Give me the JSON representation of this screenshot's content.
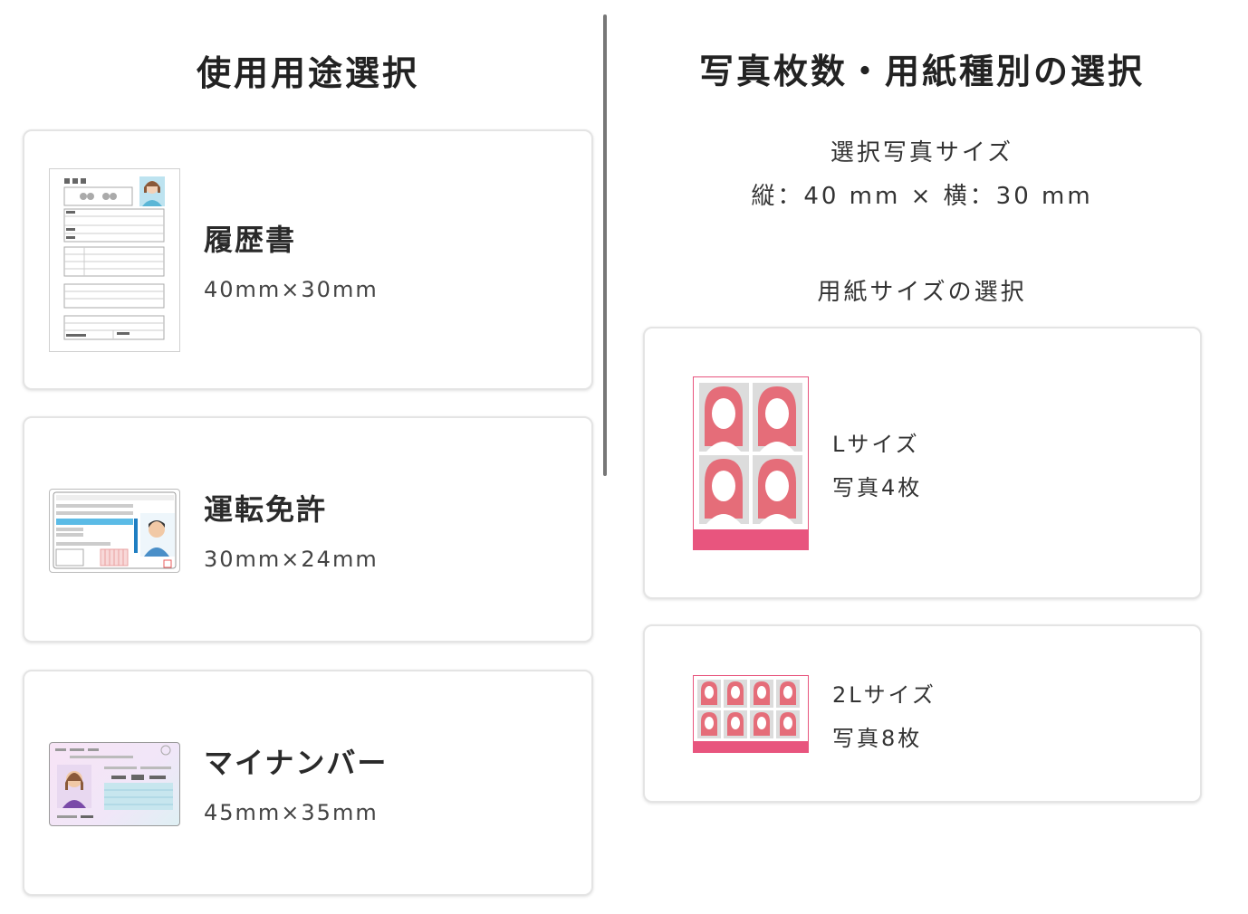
{
  "left": {
    "heading": "使用用途選択",
    "cards": [
      {
        "title": "履歴書",
        "size": "40mm×30mm",
        "icon": "resume-icon"
      },
      {
        "title": "運転免許",
        "size": "30mm×24mm",
        "icon": "drivers-license-icon"
      },
      {
        "title": "マイナンバー",
        "size": "45mm×35mm",
        "icon": "my-number-card-icon"
      }
    ]
  },
  "right": {
    "heading": "写真枚数・用紙種別の選択",
    "selected_label": "選択写真サイズ",
    "selected_dims": "縦：40 mm × 横：30 mm",
    "paper_label": "用紙サイズの選択",
    "papers": [
      {
        "name": "Lサイズ",
        "count": "写真4枚",
        "icon": "l-size-photo-sheet-icon"
      },
      {
        "name": "2Lサイズ",
        "count": "写真8枚",
        "icon": "2l-size-photo-sheet-icon"
      }
    ]
  },
  "colors": {
    "accent_pink": "#e8557e",
    "mynumber_bg": "#f3e3f3",
    "license_blue": "#5bbbe6"
  }
}
